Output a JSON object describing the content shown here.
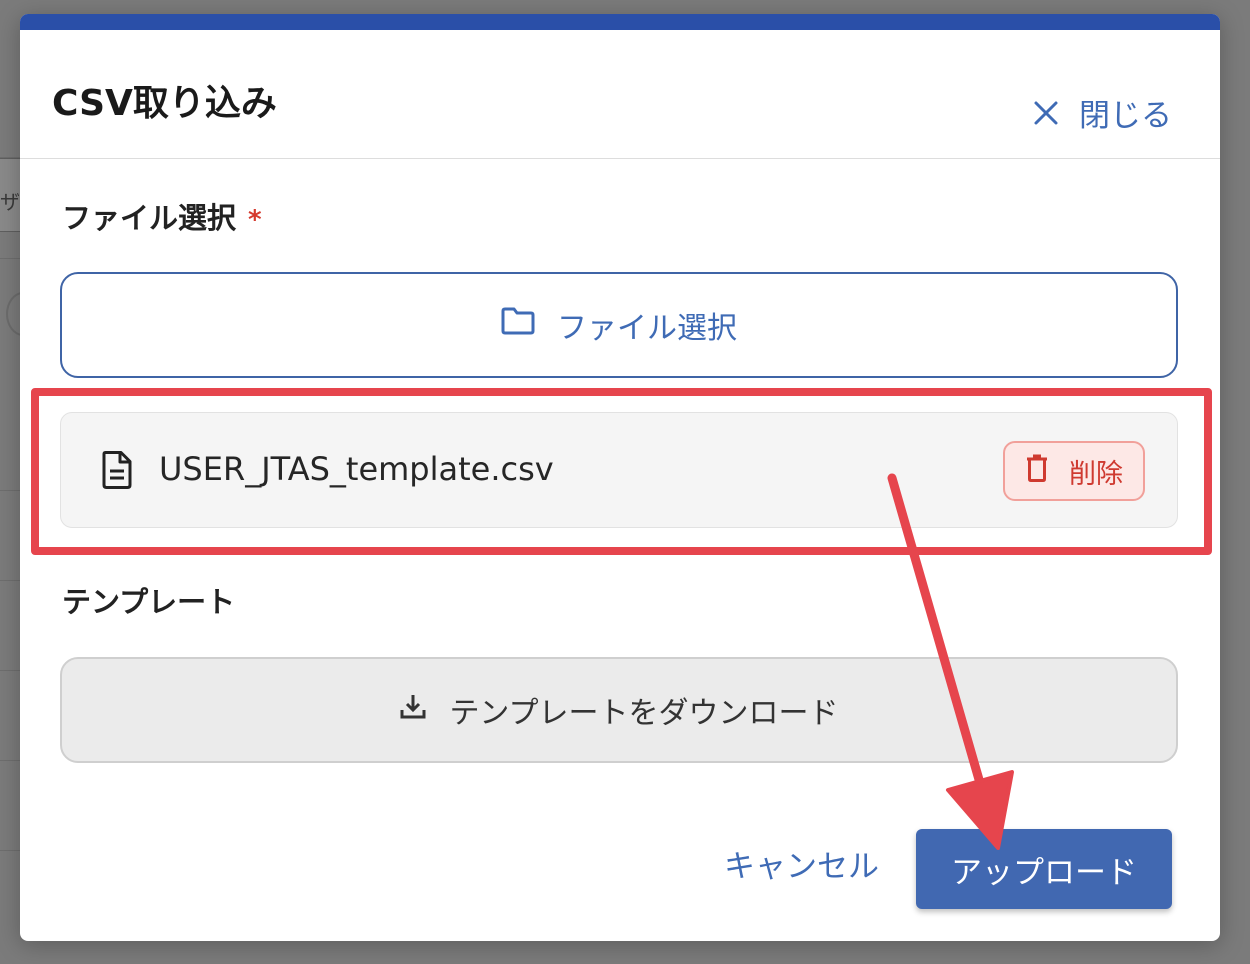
{
  "background": {
    "partial_text": "ザ"
  },
  "modal": {
    "title": "CSV取り込み",
    "close_label": "閉じる",
    "file_section": {
      "label": "ファイル選択",
      "required_mark": "*",
      "select_button_label": "ファイル選択",
      "selected_file": {
        "name": "USER_JTAS_template.csv",
        "delete_label": "削除"
      }
    },
    "template_section": {
      "label": "テンプレート",
      "download_button_label": "テンプレートをダウンロード"
    },
    "footer": {
      "cancel_label": "キャンセル",
      "upload_label": "アップロード"
    }
  },
  "colors": {
    "accent": "#4168b1",
    "top_bar": "#2a4fa8",
    "danger": "#cf3a30",
    "annotation": "#e6454d"
  },
  "icons": {
    "close": "close-icon",
    "folder": "folder-icon",
    "file": "file-document-icon",
    "delete": "trash-icon",
    "download": "download-icon"
  }
}
